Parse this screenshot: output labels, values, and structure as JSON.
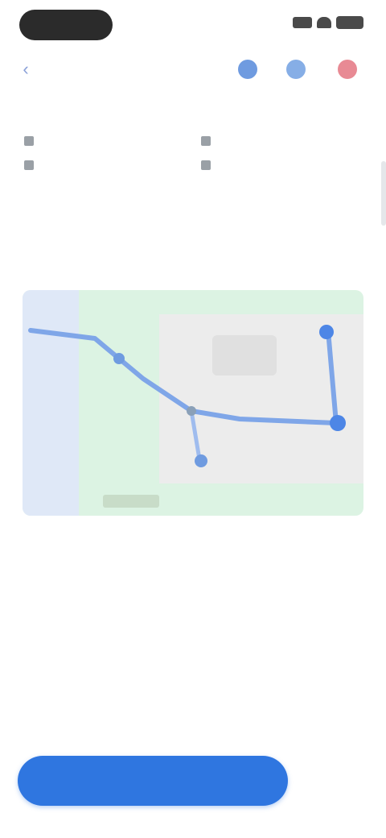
{
  "status": {
    "icons": [
      "signal-icon",
      "wifi-icon",
      "battery-icon"
    ]
  },
  "header": {
    "back_icon": "arrow-left-icon",
    "title": "",
    "actions": [
      "directions-icon",
      "share-icon",
      "save-icon"
    ]
  },
  "overview": {
    "title": "",
    "left_card": [
      "",
      "",
      ""
    ],
    "right_card": [
      "",
      "",
      ""
    ],
    "more_link": ""
  },
  "map_section": {
    "title": "",
    "caption": "",
    "caption_link": ""
  },
  "route": {
    "items": [
      {
        "num": "",
        "name": "",
        "time": ""
      },
      {
        "num": "",
        "name": "",
        "time": ""
      },
      {
        "num": "",
        "name": "",
        "time": ""
      },
      {
        "num": "",
        "name": "",
        "time": ""
      }
    ],
    "more_link": ""
  },
  "actions": {
    "primary_label": "",
    "secondary_label": ""
  },
  "colors": {
    "accent": "#2f76e0",
    "map_green": "#dcf3e3",
    "route_line": "#7fa6e8"
  }
}
